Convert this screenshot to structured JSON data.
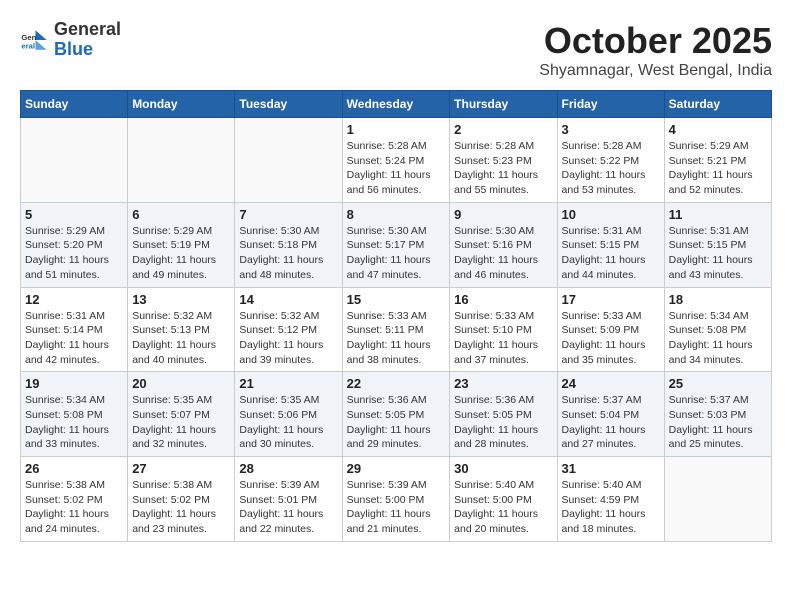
{
  "header": {
    "logo_general": "General",
    "logo_blue": "Blue",
    "month_title": "October 2025",
    "location": "Shyamnagar, West Bengal, India"
  },
  "days_of_week": [
    "Sunday",
    "Monday",
    "Tuesday",
    "Wednesday",
    "Thursday",
    "Friday",
    "Saturday"
  ],
  "weeks": [
    [
      {
        "day": "",
        "info": ""
      },
      {
        "day": "",
        "info": ""
      },
      {
        "day": "",
        "info": ""
      },
      {
        "day": "1",
        "info": "Sunrise: 5:28 AM\nSunset: 5:24 PM\nDaylight: 11 hours and 56 minutes."
      },
      {
        "day": "2",
        "info": "Sunrise: 5:28 AM\nSunset: 5:23 PM\nDaylight: 11 hours and 55 minutes."
      },
      {
        "day": "3",
        "info": "Sunrise: 5:28 AM\nSunset: 5:22 PM\nDaylight: 11 hours and 53 minutes."
      },
      {
        "day": "4",
        "info": "Sunrise: 5:29 AM\nSunset: 5:21 PM\nDaylight: 11 hours and 52 minutes."
      }
    ],
    [
      {
        "day": "5",
        "info": "Sunrise: 5:29 AM\nSunset: 5:20 PM\nDaylight: 11 hours and 51 minutes."
      },
      {
        "day": "6",
        "info": "Sunrise: 5:29 AM\nSunset: 5:19 PM\nDaylight: 11 hours and 49 minutes."
      },
      {
        "day": "7",
        "info": "Sunrise: 5:30 AM\nSunset: 5:18 PM\nDaylight: 11 hours and 48 minutes."
      },
      {
        "day": "8",
        "info": "Sunrise: 5:30 AM\nSunset: 5:17 PM\nDaylight: 11 hours and 47 minutes."
      },
      {
        "day": "9",
        "info": "Sunrise: 5:30 AM\nSunset: 5:16 PM\nDaylight: 11 hours and 46 minutes."
      },
      {
        "day": "10",
        "info": "Sunrise: 5:31 AM\nSunset: 5:15 PM\nDaylight: 11 hours and 44 minutes."
      },
      {
        "day": "11",
        "info": "Sunrise: 5:31 AM\nSunset: 5:15 PM\nDaylight: 11 hours and 43 minutes."
      }
    ],
    [
      {
        "day": "12",
        "info": "Sunrise: 5:31 AM\nSunset: 5:14 PM\nDaylight: 11 hours and 42 minutes."
      },
      {
        "day": "13",
        "info": "Sunrise: 5:32 AM\nSunset: 5:13 PM\nDaylight: 11 hours and 40 minutes."
      },
      {
        "day": "14",
        "info": "Sunrise: 5:32 AM\nSunset: 5:12 PM\nDaylight: 11 hours and 39 minutes."
      },
      {
        "day": "15",
        "info": "Sunrise: 5:33 AM\nSunset: 5:11 PM\nDaylight: 11 hours and 38 minutes."
      },
      {
        "day": "16",
        "info": "Sunrise: 5:33 AM\nSunset: 5:10 PM\nDaylight: 11 hours and 37 minutes."
      },
      {
        "day": "17",
        "info": "Sunrise: 5:33 AM\nSunset: 5:09 PM\nDaylight: 11 hours and 35 minutes."
      },
      {
        "day": "18",
        "info": "Sunrise: 5:34 AM\nSunset: 5:08 PM\nDaylight: 11 hours and 34 minutes."
      }
    ],
    [
      {
        "day": "19",
        "info": "Sunrise: 5:34 AM\nSunset: 5:08 PM\nDaylight: 11 hours and 33 minutes."
      },
      {
        "day": "20",
        "info": "Sunrise: 5:35 AM\nSunset: 5:07 PM\nDaylight: 11 hours and 32 minutes."
      },
      {
        "day": "21",
        "info": "Sunrise: 5:35 AM\nSunset: 5:06 PM\nDaylight: 11 hours and 30 minutes."
      },
      {
        "day": "22",
        "info": "Sunrise: 5:36 AM\nSunset: 5:05 PM\nDaylight: 11 hours and 29 minutes."
      },
      {
        "day": "23",
        "info": "Sunrise: 5:36 AM\nSunset: 5:05 PM\nDaylight: 11 hours and 28 minutes."
      },
      {
        "day": "24",
        "info": "Sunrise: 5:37 AM\nSunset: 5:04 PM\nDaylight: 11 hours and 27 minutes."
      },
      {
        "day": "25",
        "info": "Sunrise: 5:37 AM\nSunset: 5:03 PM\nDaylight: 11 hours and 25 minutes."
      }
    ],
    [
      {
        "day": "26",
        "info": "Sunrise: 5:38 AM\nSunset: 5:02 PM\nDaylight: 11 hours and 24 minutes."
      },
      {
        "day": "27",
        "info": "Sunrise: 5:38 AM\nSunset: 5:02 PM\nDaylight: 11 hours and 23 minutes."
      },
      {
        "day": "28",
        "info": "Sunrise: 5:39 AM\nSunset: 5:01 PM\nDaylight: 11 hours and 22 minutes."
      },
      {
        "day": "29",
        "info": "Sunrise: 5:39 AM\nSunset: 5:00 PM\nDaylight: 11 hours and 21 minutes."
      },
      {
        "day": "30",
        "info": "Sunrise: 5:40 AM\nSunset: 5:00 PM\nDaylight: 11 hours and 20 minutes."
      },
      {
        "day": "31",
        "info": "Sunrise: 5:40 AM\nSunset: 4:59 PM\nDaylight: 11 hours and 18 minutes."
      },
      {
        "day": "",
        "info": ""
      }
    ]
  ]
}
